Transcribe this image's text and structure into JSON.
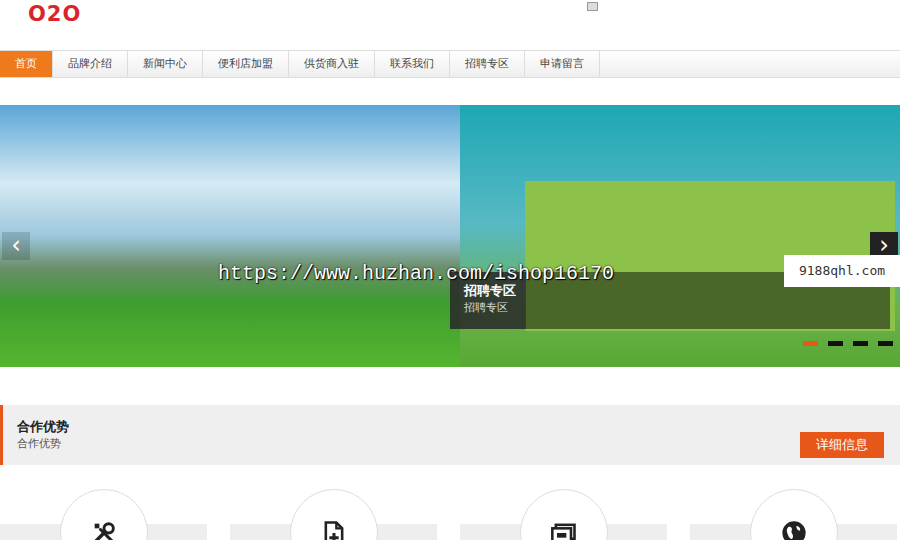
{
  "logo": "O2O",
  "nav": [
    {
      "label": "首页",
      "selected": true
    },
    {
      "label": "品牌介绍",
      "selected": false
    },
    {
      "label": "新闻中心",
      "selected": false
    },
    {
      "label": "便利店加盟",
      "selected": false
    },
    {
      "label": "供货商入驻",
      "selected": false
    },
    {
      "label": "联系我们",
      "selected": false
    },
    {
      "label": "招聘专区",
      "selected": false
    },
    {
      "label": "申请留言",
      "selected": false
    }
  ],
  "banner": {
    "caption_title": "招聘专区",
    "caption_sub": "招聘专区",
    "prev": "‹",
    "next": "›",
    "dots": [
      {
        "selected": true
      },
      {
        "selected": false
      },
      {
        "selected": false
      },
      {
        "selected": false
      }
    ]
  },
  "watermark": {
    "url": "https://www.huzhan.com/ishop16170",
    "site": "9188qhl.com"
  },
  "section": {
    "title": "合作优势",
    "subtitle": "合作优势",
    "button": "详细信息"
  }
}
